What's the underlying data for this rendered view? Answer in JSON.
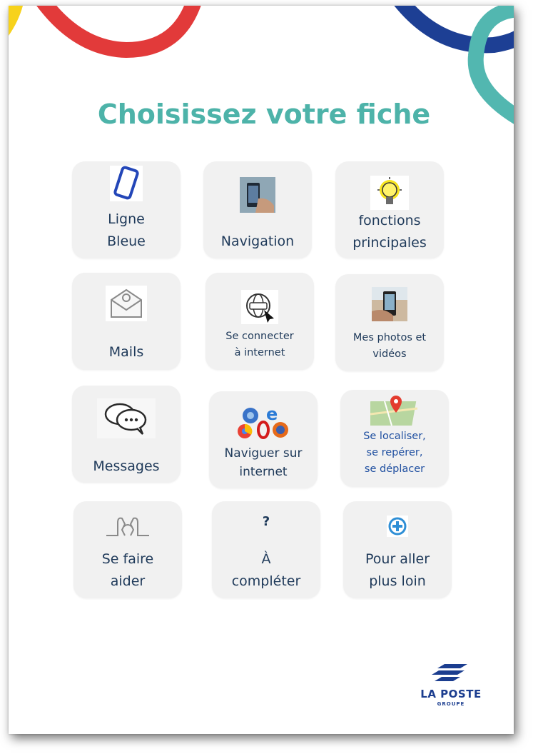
{
  "page": {
    "title": "Choisissez votre fiche",
    "colors": {
      "title": "#4db3a9",
      "tile_bg": "#f1f1f1",
      "label": "#1f3a5a",
      "accent_red": "#e23a3a",
      "accent_blue": "#1d3f94",
      "accent_teal": "#52b7b0",
      "accent_yellow": "#f7d21b"
    }
  },
  "tiles": [
    {
      "label": "Ligne\nBleue",
      "icon": "smartphone-icon"
    },
    {
      "label": "Navigation",
      "icon": "phone-in-hand-icon"
    },
    {
      "label": "fonctions\nprincipales",
      "icon": "lightbulb-icon"
    },
    {
      "label": "Mails",
      "icon": "envelope-icon"
    },
    {
      "label": "Se connecter\nà internet",
      "icon": "www-globe-icon"
    },
    {
      "label": "Mes photos et\nvidéos",
      "icon": "camera-phone-icon"
    },
    {
      "label": "Messages",
      "icon": "chat-bubbles-icon"
    },
    {
      "label": "Naviguer sur\ninternet",
      "icon": "browsers-icon"
    },
    {
      "label": "Se localiser,\nse repérer,\nse déplacer",
      "icon": "map-pin-icon"
    },
    {
      "label": "Se faire\naider",
      "icon": "helping-hands-icon"
    },
    {
      "label": "À\ncompléter",
      "icon": "?"
    },
    {
      "label": "Pour aller\nplus loin",
      "icon": "plus-circle-icon"
    }
  ],
  "logo": {
    "name": "LA POSTE",
    "sub": "GROUPE"
  }
}
